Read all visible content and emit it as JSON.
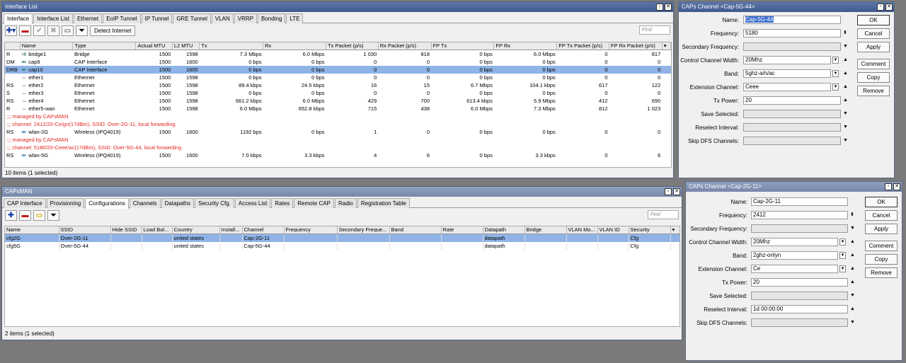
{
  "interface_list": {
    "title": "Interface List",
    "tabs": [
      "Interface",
      "Interface List",
      "Ethernet",
      "EoIP Tunnel",
      "IP Tunnel",
      "GRE Tunnel",
      "VLAN",
      "VRRP",
      "Bonding",
      "LTE"
    ],
    "detect_label": "Detect Internet",
    "find_placeholder": "Find",
    "columns": [
      "",
      "Name",
      "Type",
      "Actual MTU",
      "L2 MTU",
      "Tx",
      "Rx",
      "Tx Packet (p/s)",
      "Rx Packet (p/s)",
      "FP Tx",
      "FP Rx",
      "FP Tx Packet (p/s)",
      "FP Rx Packet (p/s)"
    ],
    "rows": [
      {
        "flag": "R",
        "icon": "bridge",
        "name": "bridge1",
        "type": "Bridge",
        "mtu": "1500",
        "l2": "1598",
        "tx": "7.3 Mbps",
        "rx": "6.0 Mbps",
        "txp": "1 030",
        "rxp": "818",
        "fptx": "0 bps",
        "fprx": "6.0 Mbps",
        "fptxp": "0",
        "fprxp": "817"
      },
      {
        "flag": "DM",
        "icon": "cap",
        "name": "cap9",
        "type": "CAP Interface",
        "mtu": "1500",
        "l2": "1600",
        "tx": "0 bps",
        "rx": "0 bps",
        "txp": "0",
        "rxp": "0",
        "fptx": "0 bps",
        "fprx": "0 bps",
        "fptxp": "0",
        "fprxp": "0"
      },
      {
        "flag": "DRB",
        "icon": "cap",
        "name": "cap10",
        "type": "CAP Interface",
        "mtu": "1500",
        "l2": "1600",
        "tx": "0 bps",
        "rx": "0 bps",
        "txp": "0",
        "rxp": "0",
        "fptx": "0 bps",
        "fprx": "0 bps",
        "fptxp": "0",
        "fprxp": "0",
        "selected": true
      },
      {
        "flag": "",
        "icon": "eth",
        "name": "ether1",
        "type": "Ethernet",
        "mtu": "1500",
        "l2": "1598",
        "tx": "0 bps",
        "rx": "0 bps",
        "txp": "0",
        "rxp": "0",
        "fptx": "0 bps",
        "fprx": "0 bps",
        "fptxp": "0",
        "fprxp": "0"
      },
      {
        "flag": "RS",
        "icon": "eth",
        "name": "ether2",
        "type": "Ethernet",
        "mtu": "1500",
        "l2": "1598",
        "tx": "89.4 kbps",
        "rx": "24.5 kbps",
        "txp": "16",
        "rxp": "15",
        "fptx": "6.7 Mbps",
        "fprx": "104.1 kbps",
        "fptxp": "617",
        "fprxp": "122"
      },
      {
        "flag": "S",
        "icon": "eth",
        "name": "ether3",
        "type": "Ethernet",
        "mtu": "1500",
        "l2": "1598",
        "tx": "0 bps",
        "rx": "0 bps",
        "txp": "0",
        "rxp": "0",
        "fptx": "0 bps",
        "fprx": "0 bps",
        "fptxp": "0",
        "fprxp": "0"
      },
      {
        "flag": "RS",
        "icon": "eth",
        "name": "ether4",
        "type": "Ethernet",
        "mtu": "1500",
        "l2": "1598",
        "tx": "661.2 kbps",
        "rx": "6.0 Mbps",
        "txp": "429",
        "rxp": "700",
        "fptx": "613.4 kbps",
        "fprx": "5.9 Mbps",
        "fptxp": "412",
        "fprxp": "690"
      },
      {
        "flag": "R",
        "icon": "eth",
        "name": "ether5-wan",
        "type": "Ethernet",
        "mtu": "1500",
        "l2": "1598",
        "tx": "6.0 Mbps",
        "rx": "652.8 kbps",
        "txp": "715",
        "rxp": "438",
        "fptx": "6.0 Mbps",
        "fprx": "7.3 Mbps",
        "fptxp": "812",
        "fprxp": "1 023"
      },
      {
        "comment": ";;; managed by CAPsMAN"
      },
      {
        "comment": ";;; channel: 2412/20-Ce/gn(17dBm), SSID: Over-2G-11, local forwarding"
      },
      {
        "flag": "RS",
        "icon": "wlan",
        "name": "wlan-2G",
        "type": "Wireless (IPQ4019)",
        "mtu": "1500",
        "l2": "1600",
        "tx": "1192 bps",
        "rx": "0 bps",
        "txp": "1",
        "rxp": "0",
        "fptx": "0 bps",
        "fprx": "0 bps",
        "fptxp": "0",
        "fprxp": "0"
      },
      {
        "comment": ";;; managed by CAPsMAN"
      },
      {
        "comment": ";;; channel: 5180/20-Ceee/ac(17dBm), SSID: Over-5G-44, local forwarding"
      },
      {
        "flag": "RS",
        "icon": "wlan",
        "name": "wlan-5G",
        "type": "Wireless (IPQ4019)",
        "mtu": "1500",
        "l2": "1600",
        "tx": "7.0 kbps",
        "rx": "3.3 kbps",
        "txp": "4",
        "rxp": "6",
        "fptx": "0 bps",
        "fprx": "3.3 kbps",
        "fptxp": "0",
        "fprxp": "6"
      }
    ],
    "status": "10 items (1 selected)"
  },
  "capsman": {
    "title": "CAPsMAN",
    "tabs": [
      "CAP Interface",
      "Provisioning",
      "Configurations",
      "Channels",
      "Datapaths",
      "Security Cfg.",
      "Access List",
      "Rates",
      "Remote CAP",
      "Radio",
      "Registration Table"
    ],
    "find_placeholder": "Find",
    "columns": [
      "Name",
      "SSID",
      "Hide SSID",
      "Load Bal...",
      "Country",
      "Install...",
      "Channel",
      "Frequency",
      "Secondary Freque...",
      "Band",
      "Rate",
      "Datapath",
      "Bridge",
      "VLAN Mo...",
      "VLAN ID",
      "Security"
    ],
    "rows": [
      {
        "name": "cfg2G",
        "ssid": "Over-2G-11",
        "country": "united states",
        "channel": "Cap-2G-11",
        "datapath": "datapath",
        "security": "Cfg",
        "selected": true
      },
      {
        "name": "cfg5G",
        "ssid": "Over-5G-44",
        "country": "united states",
        "channel": "Cap-5G-44",
        "datapath": "datapath",
        "security": "Cfg"
      }
    ],
    "status": "2 items (1 selected)"
  },
  "channel_5g": {
    "title": "CAPs Channel <Cap-5G-44>",
    "fields": {
      "name_label": "Name:",
      "name": "Cap-5G-44",
      "freq_label": "Frequency:",
      "freq": "5180",
      "secfreq_label": "Secondary Frequency:",
      "secfreq": "",
      "ctrlw_label": "Control Channel Width:",
      "ctrlw": "20Mhz",
      "band_label": "Band:",
      "band": "5ghz-a/n/ac",
      "ext_label": "Extension Channel:",
      "ext": "Ceee",
      "txp_label": "Tx Power:",
      "txp": "20",
      "save_label": "Save Selected:",
      "save": "",
      "resel_label": "Reselect Interval:",
      "resel": "",
      "dfs_label": "Skip DFS Channels:",
      "dfs": ""
    },
    "buttons": [
      "OK",
      "Cancel",
      "Apply",
      "Comment",
      "Copy",
      "Remove"
    ]
  },
  "channel_2g": {
    "title": "CAPs Channel <Cap-2G-11>",
    "fields": {
      "name_label": "Name:",
      "name": "Cap-2G-11",
      "freq_label": "Frequency:",
      "freq": "2412",
      "secfreq_label": "Secondary Frequency:",
      "secfreq": "",
      "ctrlw_label": "Control Channel Width:",
      "ctrlw": "20Mhz",
      "band_label": "Band:",
      "band": "2ghz-onlyn",
      "ext_label": "Extension Channel:",
      "ext": "Ce",
      "txp_label": "Tx Power:",
      "txp": "20",
      "save_label": "Save Selected:",
      "save": "",
      "resel_label": "Reselect Interval:",
      "resel": "1d 00:00:00",
      "dfs_label": "Skip DFS Channels:",
      "dfs": ""
    },
    "buttons": [
      "OK",
      "Cancel",
      "Apply",
      "Comment",
      "Copy",
      "Remove"
    ]
  }
}
